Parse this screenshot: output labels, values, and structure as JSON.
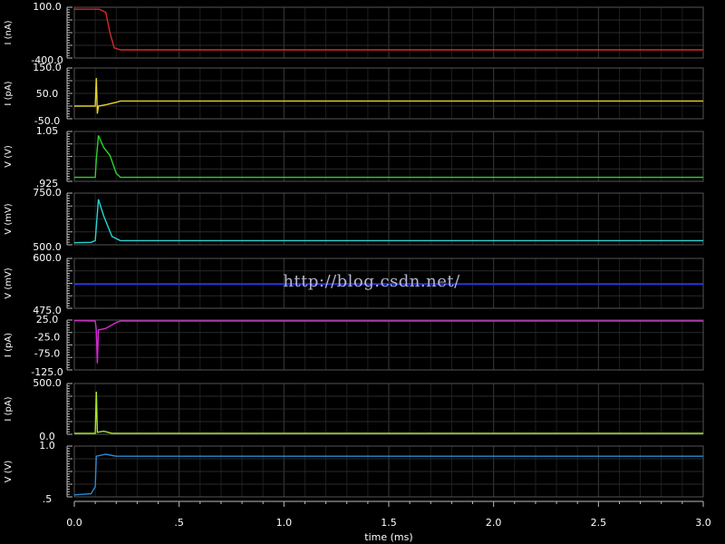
{
  "watermark": "http://blog.csdn.net/",
  "chart_data": {
    "type": "line",
    "title": "",
    "x_axis": {
      "label": "time (ms)",
      "range": [
        0,
        3.0
      ],
      "ticks": [
        0,
        0.5,
        1.0,
        1.5,
        2.0,
        2.5,
        3.0
      ],
      "tick_labels": [
        "0.0",
        ".5",
        "1.0",
        "1.5",
        "2.0",
        "2.5",
        "3.0"
      ]
    },
    "grid": true,
    "background": "#000000",
    "panels": [
      {
        "ylabel": "I (nA)",
        "ylim": [
          -400,
          100
        ],
        "tick_labels": [
          "100.0",
          "-400.0"
        ],
        "color": "#d42a2a",
        "points": [
          [
            0,
            80
          ],
          [
            0.12,
            80
          ],
          [
            0.15,
            50
          ],
          [
            0.17,
            -150
          ],
          [
            0.19,
            -300
          ],
          [
            0.22,
            -320
          ],
          [
            3.0,
            -320
          ]
        ]
      },
      {
        "ylabel": "I (pA)",
        "ylim": [
          -50,
          150
        ],
        "tick_labels": [
          "150.0",
          "50.0",
          "-50.0"
        ],
        "color": "#e6d22a",
        "points": [
          [
            0,
            0
          ],
          [
            0.1,
            0
          ],
          [
            0.105,
            110
          ],
          [
            0.11,
            -30
          ],
          [
            0.115,
            0
          ],
          [
            0.15,
            5
          ],
          [
            0.2,
            15
          ],
          [
            0.22,
            20
          ],
          [
            3.0,
            20
          ]
        ]
      },
      {
        "ylabel": "V (V)",
        "ylim": [
          0.925,
          1.05
        ],
        "tick_labels": [
          "1.05",
          ".925"
        ],
        "color": "#2ad42a",
        "points": [
          [
            0,
            0.935
          ],
          [
            0.1,
            0.935
          ],
          [
            0.105,
            0.98
          ],
          [
            0.115,
            1.04
          ],
          [
            0.14,
            1.01
          ],
          [
            0.17,
            0.99
          ],
          [
            0.2,
            0.945
          ],
          [
            0.22,
            0.935
          ],
          [
            3.0,
            0.935
          ]
        ]
      },
      {
        "ylabel": "V (mV)",
        "ylim": [
          500,
          750
        ],
        "tick_labels": [
          "750.0",
          "500.0"
        ],
        "color": "#2ad4d4",
        "points": [
          [
            0,
            510
          ],
          [
            0.08,
            512
          ],
          [
            0.1,
            520
          ],
          [
            0.115,
            720
          ],
          [
            0.14,
            640
          ],
          [
            0.18,
            540
          ],
          [
            0.22,
            520
          ],
          [
            3.0,
            520
          ]
        ]
      },
      {
        "ylabel": "V (mV)",
        "ylim": [
          475,
          600
        ],
        "tick_labels": [
          "600.0",
          "475.0"
        ],
        "color": "#2a3ae6",
        "points": [
          [
            0,
            535
          ],
          [
            3.0,
            535
          ]
        ]
      },
      {
        "ylabel": "I (pA)",
        "ylim": [
          -125,
          25
        ],
        "tick_labels": [
          "25.0",
          "-25.0",
          "-75.0",
          "-125.0"
        ],
        "color": "#d42ad4",
        "points": [
          [
            0,
            23
          ],
          [
            0.1,
            22
          ],
          [
            0.105,
            -5
          ],
          [
            0.11,
            -105
          ],
          [
            0.115,
            -5
          ],
          [
            0.15,
            0
          ],
          [
            0.2,
            18
          ],
          [
            0.22,
            22
          ],
          [
            3.0,
            22
          ]
        ]
      },
      {
        "ylabel": "I (pA)",
        "ylim": [
          0,
          500
        ],
        "tick_labels": [
          "500.0",
          "0.0"
        ],
        "color": "#a8e62a",
        "points": [
          [
            0,
            10
          ],
          [
            0.1,
            10
          ],
          [
            0.105,
            420
          ],
          [
            0.11,
            20
          ],
          [
            0.14,
            30
          ],
          [
            0.18,
            10
          ],
          [
            3.0,
            10
          ]
        ]
      },
      {
        "ylabel": "V (V)",
        "ylim": [
          0.5,
          1.0
        ],
        "tick_labels": [
          "1.0",
          ".5"
        ],
        "color": "#2a8ad4",
        "points": [
          [
            0,
            0.52
          ],
          [
            0.08,
            0.53
          ],
          [
            0.1,
            0.6
          ],
          [
            0.105,
            0.9
          ],
          [
            0.15,
            0.92
          ],
          [
            0.2,
            0.9
          ],
          [
            3.0,
            0.9
          ]
        ]
      }
    ]
  }
}
